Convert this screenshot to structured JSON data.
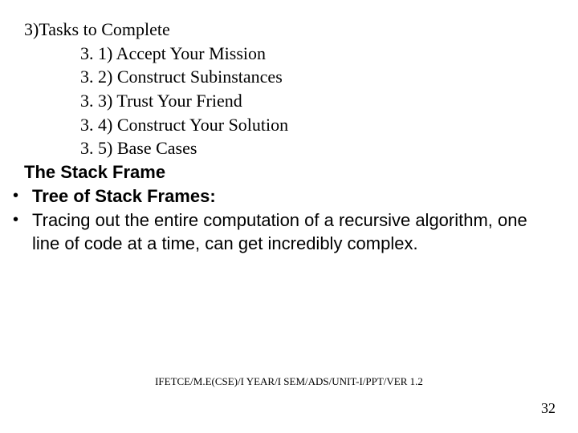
{
  "heading": "3)Tasks to Complete",
  "items": [
    "3. 1) Accept Your Mission",
    "3. 2) Construct Subinstances",
    "3. 3) Trust Your Friend",
    "3. 4) Construct Your Solution",
    "3. 5) Base Cases"
  ],
  "subheading": "The Stack Frame",
  "bullets": [
    {
      "dot": "•",
      "text": "Tree of Stack Frames:",
      "bold": true
    },
    {
      "dot": "•",
      "text": "Tracing out the entire computation of a recursive algorithm, one line of code at a time, can get incredibly complex.",
      "bold": false
    }
  ],
  "footer": "IFETCE/M.E(CSE)/I YEAR/I SEM/ADS/UNIT-I/PPT/VER 1.2",
  "pagenum": "32"
}
